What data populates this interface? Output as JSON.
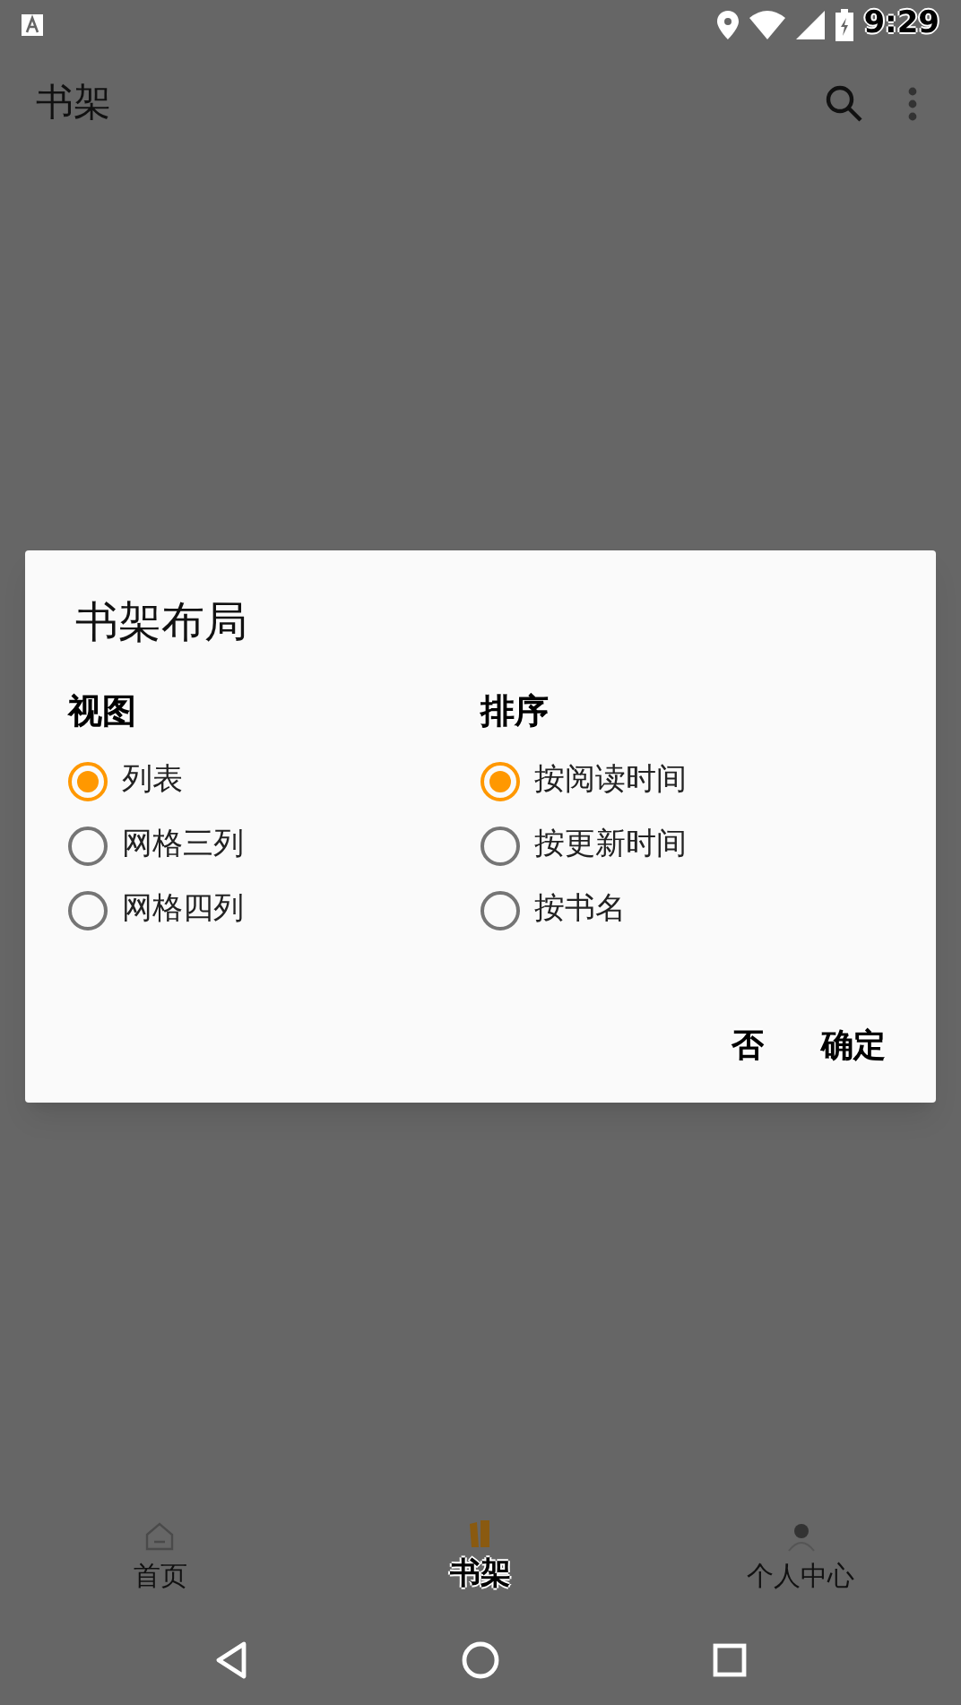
{
  "status_bar": {
    "time": "9:29"
  },
  "app_bar": {
    "title": "书架"
  },
  "dialog": {
    "title": "书架布局",
    "groups": [
      {
        "heading": "视图",
        "options": [
          {
            "label": "列表",
            "selected": true
          },
          {
            "label": "网格三列",
            "selected": false
          },
          {
            "label": "网格四列",
            "selected": false
          }
        ]
      },
      {
        "heading": "排序",
        "options": [
          {
            "label": "按阅读时间",
            "selected": true
          },
          {
            "label": "按更新时间",
            "selected": false
          },
          {
            "label": "按书名",
            "selected": false
          }
        ]
      }
    ],
    "buttons": [
      "否",
      "确定"
    ]
  },
  "bottom_nav": [
    {
      "label": "首页",
      "kind": "home",
      "selected": false
    },
    {
      "label": "书架",
      "kind": "shelf",
      "selected": true
    },
    {
      "label": "个人中心",
      "kind": "profile",
      "selected": false
    }
  ]
}
